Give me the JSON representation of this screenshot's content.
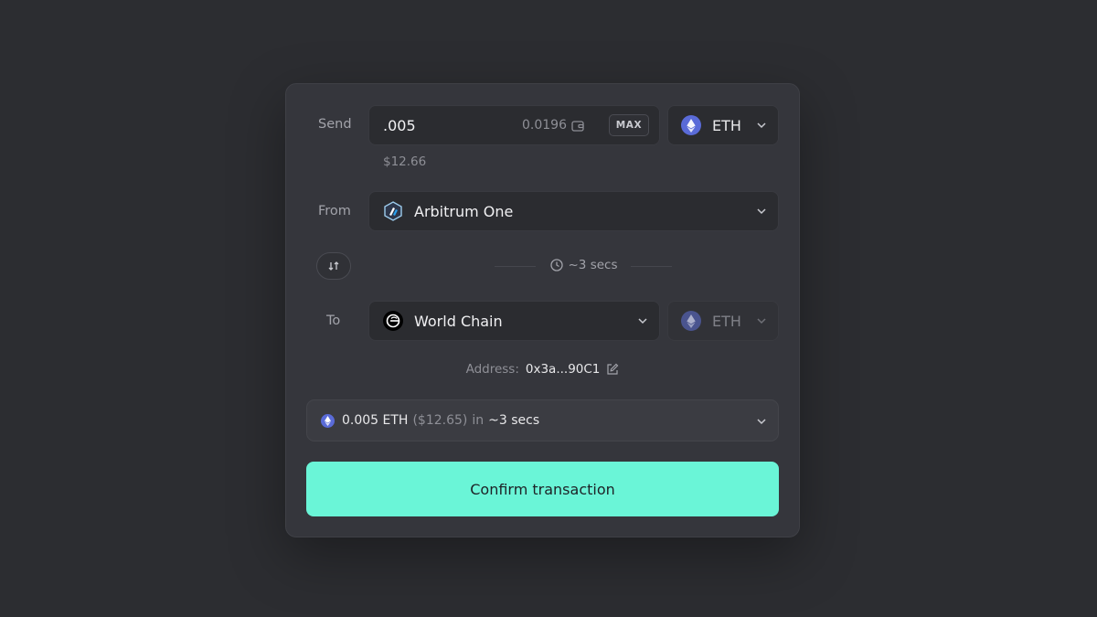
{
  "send": {
    "label": "Send",
    "amount": ".005",
    "balance": "0.0196",
    "max_label": "MAX",
    "usd_value": "$12.66",
    "token": "ETH"
  },
  "from": {
    "label": "From",
    "chain": "Arbitrum One"
  },
  "eta": "~3 secs",
  "to": {
    "label": "To",
    "chain": "World Chain",
    "token": "ETH"
  },
  "address": {
    "label": "Address:",
    "value": "0x3a...90C1"
  },
  "summary": {
    "amount": "0.005 ETH",
    "usd": "($12.65)",
    "in": "in",
    "eta": "~3 secs"
  },
  "confirm_label": "Confirm transaction",
  "colors": {
    "accent": "#6af5d7",
    "background": "#2c2d31",
    "card": "#35363c",
    "eth": "#5a6bd8"
  }
}
